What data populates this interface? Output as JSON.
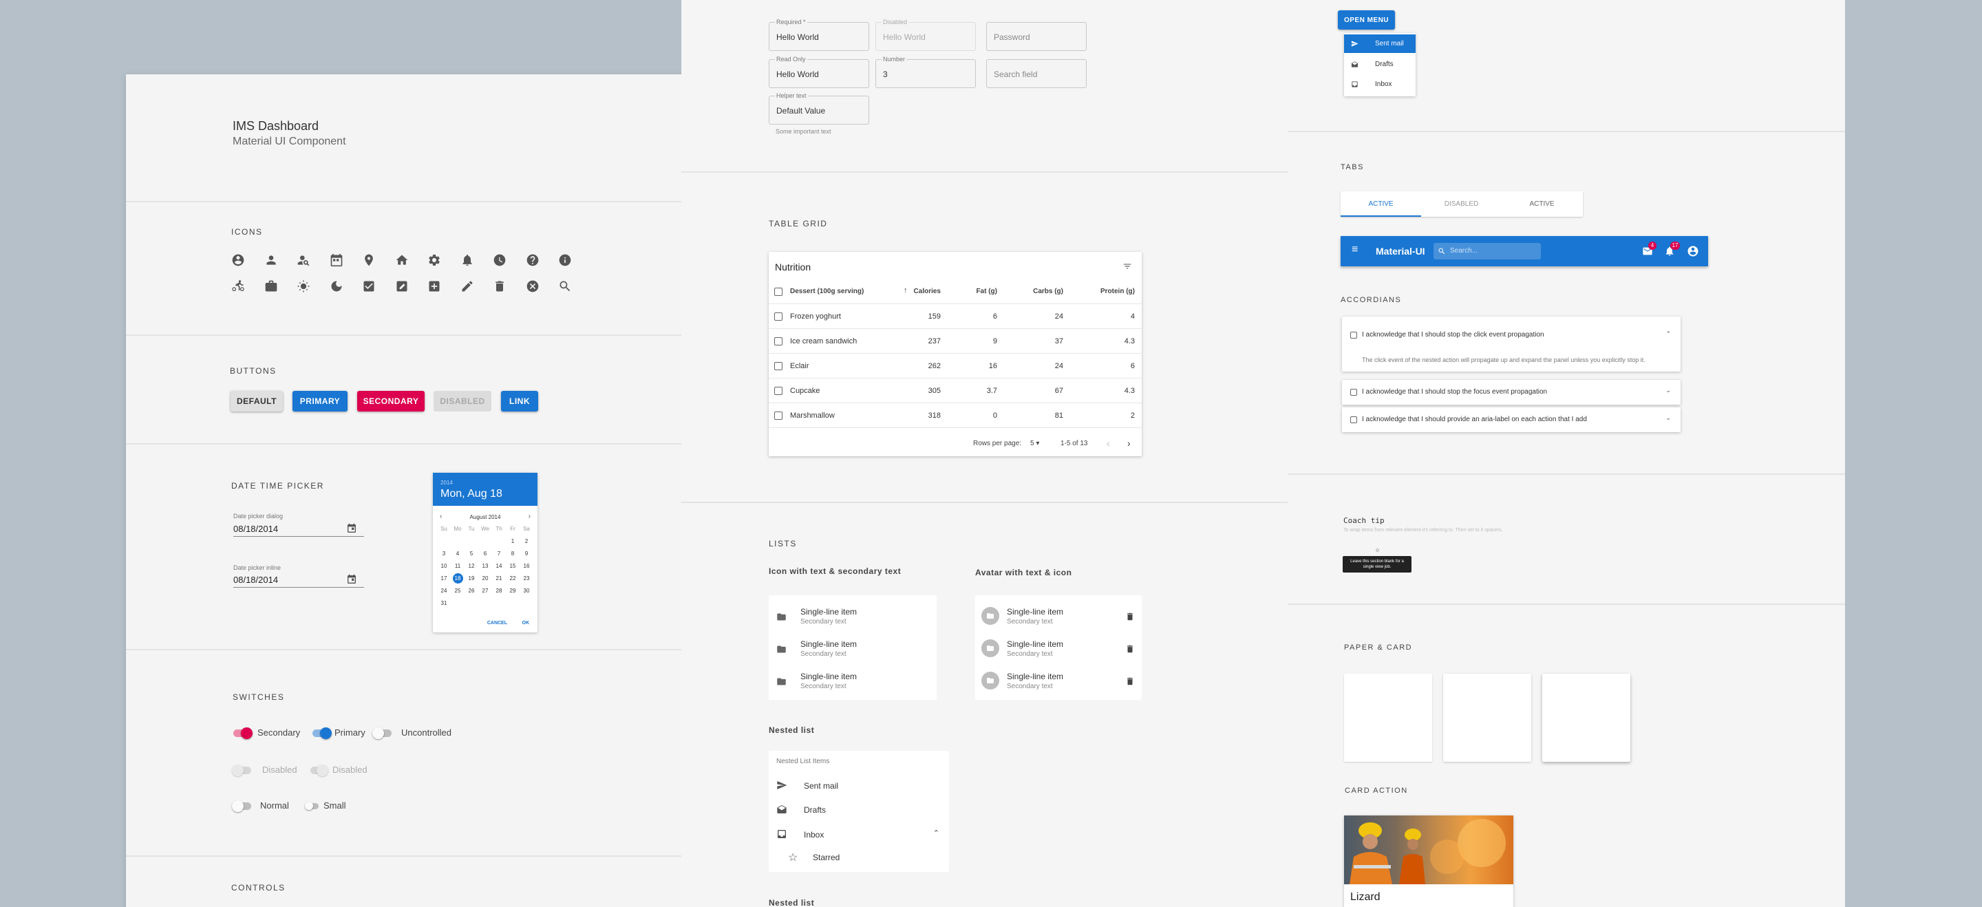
{
  "dashboard": {
    "title": "IMS Dashboard",
    "subtitle": "Material UI Component"
  },
  "sections": {
    "icons": "ICONS",
    "buttons": "BUTTONS",
    "datetime": "DATE TIME PICKER",
    "switches": "SWITCHES",
    "controls": "CONTROLS",
    "table": "TABLE GRID",
    "lists": "LISTS",
    "tabs": "TABS",
    "accordions": "ACCORDIANS",
    "paper": "PAPER & CARD",
    "card_action": "CARD ACTION"
  },
  "icons_row1": [
    "account-circle-icon",
    "person-pin-icon",
    "person-search-icon",
    "calendar-icon",
    "location-pin-icon",
    "home-icon",
    "settings-icon",
    "notifications-icon",
    "schedule-icon",
    "help-icon",
    "info-icon"
  ],
  "icons_row2": [
    "bike-icon",
    "briefcase-icon",
    "sun-icon",
    "moon-icon",
    "checkbox-icon",
    "edit-box-icon",
    "add-box-icon",
    "pencil-icon",
    "delete-icon",
    "cancel-icon",
    "search-icon"
  ],
  "buttons": {
    "default": "DEFAULT",
    "primary": "PRIMARY",
    "secondary": "SECONDARY",
    "disabled": "DISABLED",
    "link": "LINK"
  },
  "datepicker": {
    "dialog_label": "Date picker dialog",
    "dialog_value": "08/18/2014",
    "inline_label": "Date picker inline",
    "inline_value": "08/18/2014",
    "year": "2014",
    "header_date": "Mon, Aug 18",
    "month": "August 2014",
    "weekdays": [
      "Su",
      "Mo",
      "Tu",
      "We",
      "Th",
      "Fr",
      "Sa"
    ],
    "weeks": [
      [
        "",
        "",
        "",
        "",
        "",
        "1",
        "2"
      ],
      [
        "3",
        "4",
        "5",
        "6",
        "7",
        "8",
        "9"
      ],
      [
        "10",
        "11",
        "12",
        "13",
        "14",
        "15",
        "16"
      ],
      [
        "17",
        "18",
        "19",
        "20",
        "21",
        "22",
        "23"
      ],
      [
        "24",
        "25",
        "26",
        "27",
        "28",
        "29",
        "30"
      ],
      [
        "31",
        "",
        "",
        "",
        "",
        "",
        ""
      ]
    ],
    "selected": "18",
    "cancel": "CANCEL",
    "ok": "OK"
  },
  "switches": {
    "secondary": "Secondary",
    "primary": "Primary",
    "uncontrolled": "Uncontrolled",
    "disabled1": "Disabled",
    "disabled2": "Disabled",
    "normal": "Normal",
    "small": "Small"
  },
  "form": {
    "required_label": "Required *",
    "required_value": "Hello World",
    "disabled_label": "Disabled",
    "disabled_value": "Hello World",
    "password_ph": "Password",
    "readonly_label": "Read Only",
    "readonly_value": "Hello World",
    "number_label": "Number",
    "number_value": "3",
    "search_ph": "Search field",
    "helper_label": "Helper text",
    "helper_value": "Default Value",
    "helper_text": "Some important text"
  },
  "table": {
    "title": "Nutrition",
    "headers": [
      "Dessert (100g serving)",
      "Calories",
      "Fat (g)",
      "Carbs (g)",
      "Protein (g)"
    ],
    "rows": [
      [
        "Frozen yoghurt",
        "159",
        "6",
        "24",
        "4"
      ],
      [
        "Ice cream sandwich",
        "237",
        "9",
        "37",
        "4.3"
      ],
      [
        "Eclair",
        "262",
        "16",
        "24",
        "6"
      ],
      [
        "Cupcake",
        "305",
        "3.7",
        "67",
        "4.3"
      ],
      [
        "Marshmallow",
        "318",
        "0",
        "81",
        "2"
      ]
    ],
    "rows_per_page_label": "Rows per page:",
    "rows_per_page": "5",
    "range": "1-5 of 13"
  },
  "lists": {
    "col1_title": "Icon with text & secondary text",
    "col2_title": "Avatar with text & icon",
    "item": "Single-line item",
    "secondary": "Secondary text",
    "nested_title": "Nested list",
    "nested_sub": "Nested List Items",
    "nested": [
      "Sent mail",
      "Drafts",
      "Inbox",
      "Starred"
    ],
    "nested_title2": "Nested list"
  },
  "menu": {
    "button": "OPEN MENU",
    "items": [
      "Sent mail",
      "Drafts",
      "Inbox"
    ]
  },
  "tabs": [
    "ACTIVE",
    "DISABLED",
    "ACTIVE"
  ],
  "appbar": {
    "title": "Material-UI",
    "search_ph": "Search...",
    "mail_badge": "4",
    "notif_badge": "17"
  },
  "accordions": [
    {
      "label": "I acknowledge that I should stop the click event propagation",
      "detail": "The click event of the nested action will propagate up and expand the panel unless you explicitly stop it."
    },
    {
      "label": "I acknowledge that I should stop the focus event propagation"
    },
    {
      "label": "I acknowledge that I should provide an aria-label on each action that I add"
    }
  ],
  "coach": {
    "title": "Coach tip",
    "desc": "To wrap items from relevant element it's referring to. Then set to it spacers.",
    "tooltip": "Leave this section blank for a single view job."
  },
  "card": {
    "title": "Lizard"
  },
  "colors": {
    "primary": "#1976d2",
    "secondary": "#dc004e"
  }
}
